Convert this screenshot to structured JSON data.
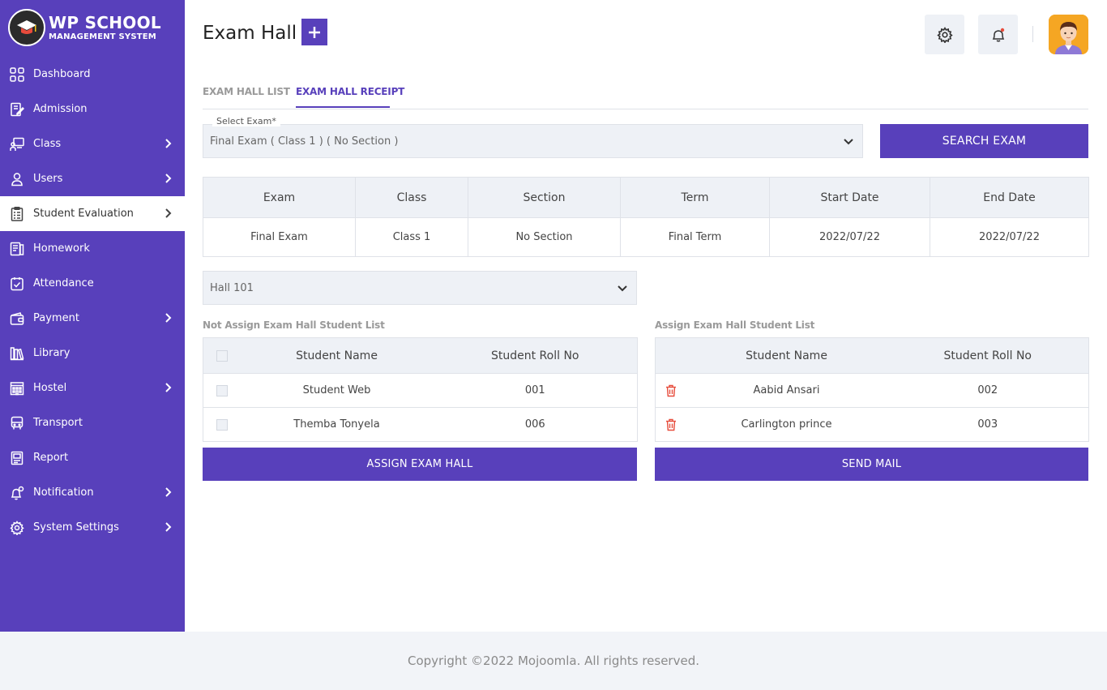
{
  "app": {
    "logo_title": "WP SCHOOL",
    "logo_subtitle": "MANAGEMENT SYSTEM"
  },
  "sidebar": {
    "items": [
      {
        "label": "Dashboard",
        "icon": "grid-icon",
        "has_submenu": false
      },
      {
        "label": "Admission",
        "icon": "edit-document-icon",
        "has_submenu": false
      },
      {
        "label": "Class",
        "icon": "classroom-icon",
        "has_submenu": true
      },
      {
        "label": "Users",
        "icon": "user-icon",
        "has_submenu": true
      },
      {
        "label": "Student Evaluation",
        "icon": "clipboard-list-icon",
        "has_submenu": true,
        "active": true
      },
      {
        "label": "Homework",
        "icon": "homework-icon",
        "has_submenu": false
      },
      {
        "label": "Attendance",
        "icon": "calendar-check-icon",
        "has_submenu": false
      },
      {
        "label": "Payment",
        "icon": "wallet-icon",
        "has_submenu": true
      },
      {
        "label": "Library",
        "icon": "library-icon",
        "has_submenu": false
      },
      {
        "label": "Hostel",
        "icon": "building-icon",
        "has_submenu": true
      },
      {
        "label": "Transport",
        "icon": "bus-icon",
        "has_submenu": false
      },
      {
        "label": "Report",
        "icon": "report-icon",
        "has_submenu": false
      },
      {
        "label": "Notification",
        "icon": "bell-settings-icon",
        "has_submenu": true
      },
      {
        "label": "System Settings",
        "icon": "gear-icon",
        "has_submenu": true
      }
    ]
  },
  "header": {
    "title": "Exam Hall",
    "add_symbol": "+"
  },
  "tabs": [
    {
      "label": "EXAM HALL LIST",
      "active": false
    },
    {
      "label": "EXAM HALL RECEIPT",
      "active": true
    }
  ],
  "exam_select": {
    "label": "Select Exam*",
    "value": "Final Exam ( Class 1 ) ( No Section )"
  },
  "search_button": "SEARCH EXAM",
  "exam_table": {
    "headers": [
      "Exam",
      "Class",
      "Section",
      "Term",
      "Start Date",
      "End Date"
    ],
    "row": [
      "Final Exam",
      "Class 1",
      "No Section",
      "Final Term",
      "2022/07/22",
      "2022/07/22"
    ]
  },
  "hall_select": {
    "value": "Hall 101"
  },
  "not_assigned": {
    "title": "Not Assign Exam Hall Student List",
    "headers": [
      "Student Name",
      "Student Roll No"
    ],
    "rows": [
      {
        "name": "Student Web",
        "roll": "001"
      },
      {
        "name": "Themba Tonyela",
        "roll": "006"
      }
    ],
    "button": "ASSIGN EXAM HALL"
  },
  "assigned": {
    "title": "Assign Exam Hall Student List",
    "headers": [
      "Student Name",
      "Student Roll No"
    ],
    "rows": [
      {
        "name": "Aabid Ansari",
        "roll": "002"
      },
      {
        "name": "Carlington prince",
        "roll": "003"
      }
    ],
    "button": "SEND MAIL"
  },
  "footer": {
    "text": "Copyright ©2022 Mojoomla. All rights reserved."
  },
  "colors": {
    "primary": "#5840bb",
    "light_bg": "#eef1f6",
    "delete": "#e74c3c"
  }
}
